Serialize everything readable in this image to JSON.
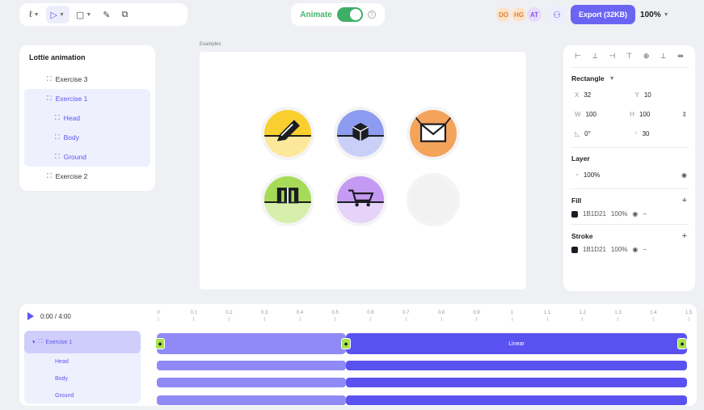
{
  "toolbar": {
    "tools": [
      {
        "icon": "pen-icon",
        "glyph": "ℓ"
      },
      {
        "icon": "shape-icon",
        "glyph": "▷"
      },
      {
        "icon": "rectangle-icon",
        "glyph": "▢"
      },
      {
        "icon": "brush-icon",
        "glyph": "✎"
      },
      {
        "icon": "image-icon",
        "glyph": "⧉"
      }
    ],
    "animate_label": "Animate",
    "animate_on": true,
    "avatars": [
      {
        "initials": "DO",
        "bg": "#fde3c8",
        "fg": "#e0833a"
      },
      {
        "initials": "HG",
        "bg": "#fde3c8",
        "fg": "#e0833a"
      },
      {
        "initials": "AT",
        "bg": "#e7dcfb",
        "fg": "#8a54e6"
      }
    ],
    "export_label": "Export (32KB)",
    "zoom": "100%"
  },
  "layers": {
    "title": "Lottie animation",
    "items": [
      {
        "label": "Exercise 3",
        "selected": false
      },
      {
        "label": "Exercise 1",
        "selected": true
      },
      {
        "label": "Head",
        "selected": true
      },
      {
        "label": "Body",
        "selected": true
      },
      {
        "label": "Ground",
        "selected": true
      },
      {
        "label": "Exercise 2",
        "selected": false
      }
    ]
  },
  "canvas": {
    "label": "Examples",
    "icons": [
      {
        "name": "pencil-icon",
        "top": "#f9cf2f",
        "bottom": "#fde79a"
      },
      {
        "name": "box-icon",
        "top": "#8d9bf0",
        "bottom": "#c9d0f8"
      },
      {
        "name": "mail-icon",
        "top": "#f4a35b",
        "bottom": "#f4a35b"
      },
      {
        "name": "book-icon",
        "top": "#a6db58",
        "bottom": "#d6efab"
      },
      {
        "name": "cart-icon",
        "top": "#c59af3",
        "bottom": "#e6d3fa"
      },
      {
        "name": "empty-icon",
        "top": "#f2f2f2",
        "bottom": "#f2f2f2"
      }
    ]
  },
  "props": {
    "align_icons": [
      "⊢",
      "⊥",
      "⊣",
      "⊤",
      "⊕",
      "⊥",
      "⇹"
    ],
    "shape": "Rectangle",
    "x_label": "X",
    "x": "32",
    "y_label": "Y",
    "y": "10",
    "w_label": "W",
    "w": "100",
    "h_label": "H",
    "h": "100",
    "rotation": "0°",
    "radius": "30",
    "layer_title": "Layer",
    "layer_opacity": "100%",
    "fill_title": "Fill",
    "fill_hex": "1B1D21",
    "fill_opacity": "100%",
    "stroke_title": "Stroke",
    "stroke_hex": "1B1D21",
    "stroke_opacity": "100%"
  },
  "timeline": {
    "time": "0:00 / 4:00",
    "ticks": [
      "0",
      "0.1",
      "0.2",
      "0.3",
      "0.4",
      "0.5",
      "0.6",
      "0.7",
      "0.8",
      "0.9",
      "1",
      "1.1",
      "1.2",
      "1.3",
      "1.4",
      "1.5"
    ],
    "track_label": "Exercise 1",
    "children": [
      "Head",
      "Body",
      "Ground"
    ],
    "easing_label": "Linear",
    "colors": {
      "bar_light": "#8f8af5",
      "bar_dark": "#5a52f0",
      "keyframe": "#a6e34a"
    }
  }
}
